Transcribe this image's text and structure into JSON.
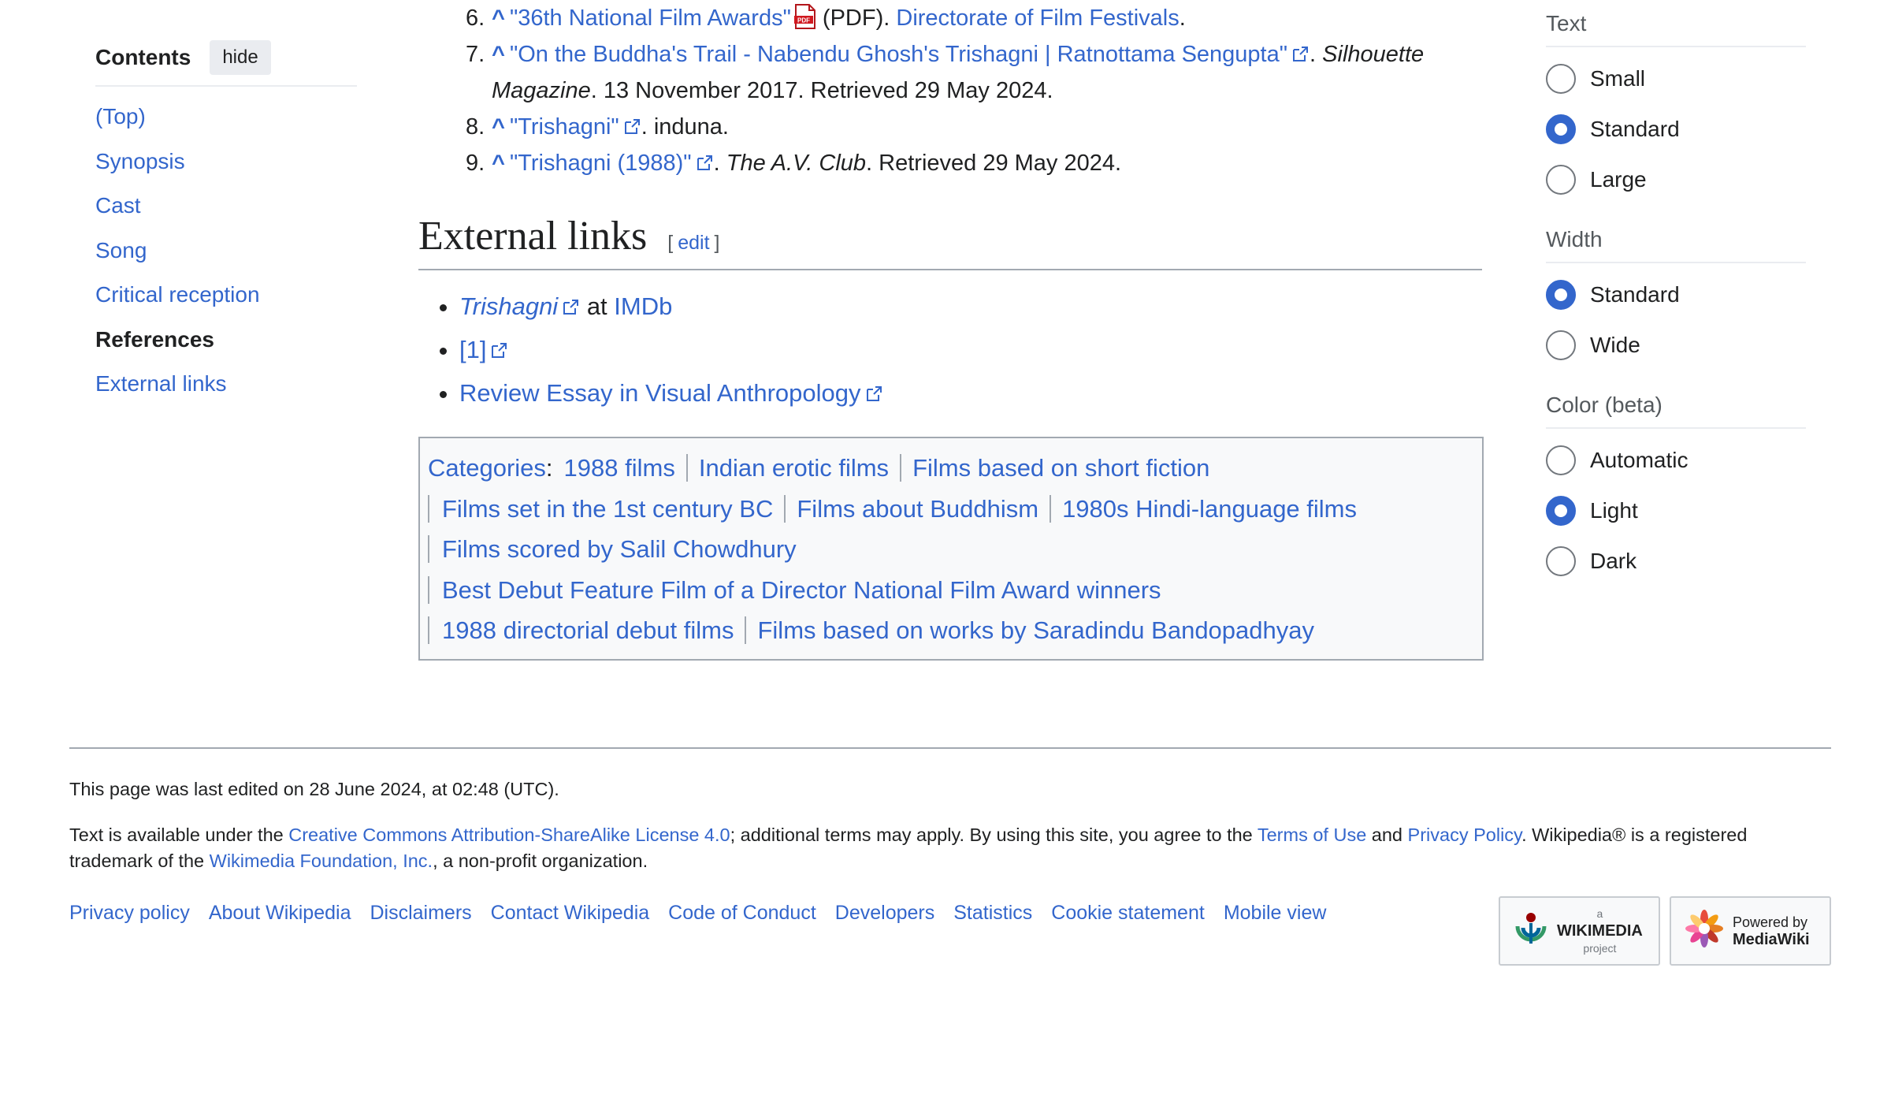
{
  "toc": {
    "title": "Contents",
    "hide_label": "hide",
    "items": [
      "(Top)",
      "Synopsis",
      "Cast",
      "Song",
      "Critical reception",
      "References",
      "External links"
    ]
  },
  "references": [
    {
      "num": "6.",
      "title": "\"36th National Film Awards\"",
      "after_pdf": " (PDF). ",
      "publisher": "Directorate of Film Festivals",
      "end": "."
    },
    {
      "num": "7.",
      "title": "\"On the Buddha's Trail - Nabendu Ghosh's Trishagni | Ratnottama Sengupta\"",
      "work": "Silhouette Magazine",
      "rest": ". 13 November 2017. Retrieved 29 May 2024."
    },
    {
      "num": "8.",
      "title": "\"Trishagni\"",
      "rest": ". induna."
    },
    {
      "num": "9.",
      "title": "\"Trishagni (1988)\"",
      "work": "The A.V. Club",
      "rest": ". Retrieved 29 May 2024."
    }
  ],
  "caret": "^",
  "external_links": {
    "heading": "External links",
    "edit_label": "edit",
    "items": [
      {
        "link": "Trishagni",
        "mid": " at ",
        "link2": "IMDb"
      },
      {
        "link": "[1]"
      },
      {
        "link": "Review Essay in Visual Anthropology"
      }
    ]
  },
  "categories": {
    "label": "Categories",
    "rows": [
      [
        "1988 films",
        "Indian erotic films",
        "Films based on short fiction"
      ],
      [
        "Films set in the 1st century BC",
        "Films about Buddhism",
        "1980s Hindi-language films"
      ],
      [
        "Films scored by Salil Chowdhury"
      ],
      [
        "Best Debut Feature Film of a Director National Film Award winners"
      ],
      [
        "1988 directorial debut films",
        "Films based on works by Saradindu Bandopadhyay"
      ]
    ]
  },
  "appearance": {
    "text": {
      "title": "Text",
      "options": [
        "Small",
        "Standard",
        "Large"
      ],
      "selected": "Standard"
    },
    "width": {
      "title": "Width",
      "options": [
        "Standard",
        "Wide"
      ],
      "selected": "Standard"
    },
    "color": {
      "title": "Color (beta)",
      "options": [
        "Automatic",
        "Light",
        "Dark"
      ],
      "selected": "Light"
    }
  },
  "footer": {
    "last_edited": "This page was last edited on 28 June 2024, at 02:48 (UTC).",
    "license_pre": "Text is available under the ",
    "license_link": "Creative Commons Attribution-ShareAlike License 4.0",
    "license_mid": "; additional terms may apply. By using this site, you agree to the ",
    "terms_link": "Terms of Use",
    "and": " and ",
    "privacy_link": "Privacy Policy",
    "license_post": ". Wikipedia® is a registered trademark of the ",
    "wmf_link": "Wikimedia Foundation, Inc.",
    "license_end": ", a non-profit organization.",
    "places": [
      "Privacy policy",
      "About Wikipedia",
      "Disclaimers",
      "Contact Wikipedia",
      "Code of Conduct",
      "Developers",
      "Statistics",
      "Cookie statement",
      "Mobile view"
    ],
    "badge_wikimedia": {
      "small": "a",
      "big": "WIKIMEDIA",
      "sub": "project"
    },
    "badge_mediawiki": {
      "line1": "Powered by",
      "line2": "MediaWiki"
    }
  },
  "colors": {
    "link": "#3366cc",
    "text": "#202122",
    "border": "#a2a9b1"
  }
}
